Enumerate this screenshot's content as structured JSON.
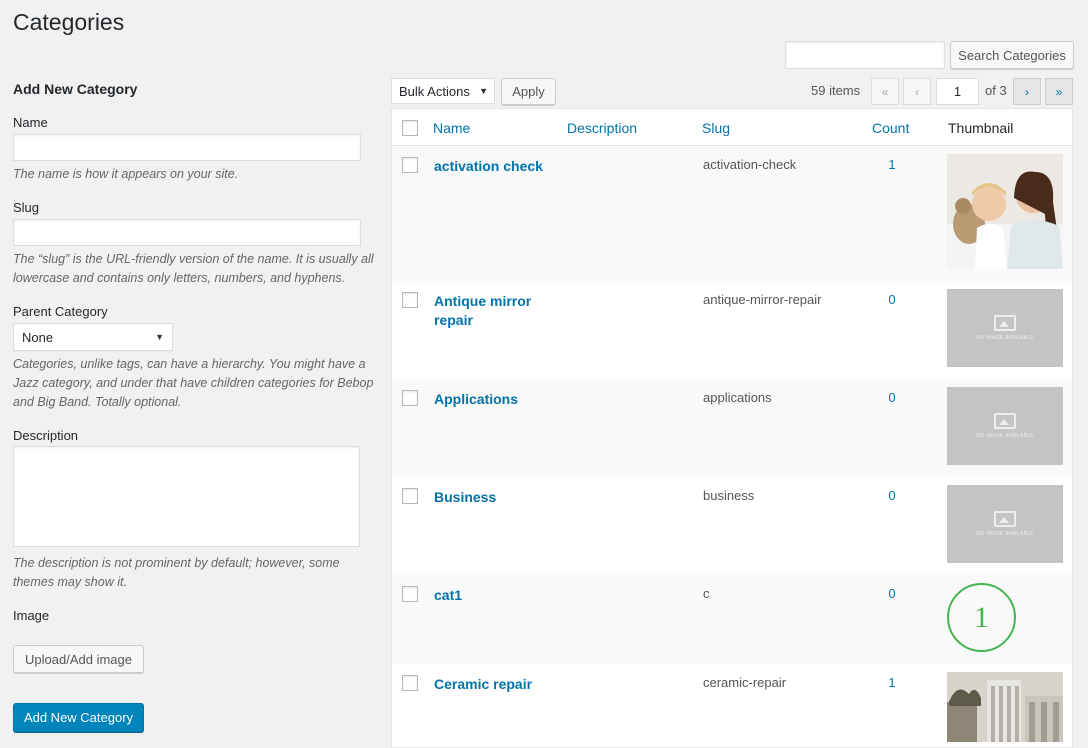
{
  "page": {
    "title": "Categories"
  },
  "search": {
    "button_label": "Search Categories",
    "value": ""
  },
  "form": {
    "heading": "Add New Category",
    "name_label": "Name",
    "name_help": "The name is how it appears on your site.",
    "slug_label": "Slug",
    "slug_help": "The “slug” is the URL-friendly version of the name. It is usually all lowercase and contains only letters, numbers, and hyphens.",
    "parent_label": "Parent Category",
    "parent_value": "None",
    "parent_help": "Categories, unlike tags, can have a hierarchy. You might have a Jazz category, and under that have children categories for Bebop and Big Band. Totally optional.",
    "description_label": "Description",
    "description_help": "The description is not prominent by default; however, some themes may show it.",
    "image_label": "Image",
    "upload_button": "Upload/Add image",
    "submit_button": "Add New Category"
  },
  "tablenav": {
    "bulk_actions": "Bulk Actions",
    "apply": "Apply",
    "items_count": "59 items",
    "first": "«",
    "prev": "‹",
    "current_page": "1",
    "of_pages": "of 3",
    "next": "›",
    "last": "»"
  },
  "table": {
    "columns": {
      "name": "Name",
      "description": "Description",
      "slug": "Slug",
      "count": "Count",
      "thumbnail": "Thumbnail"
    },
    "no_image_text": "NO IMAGE AVAILABLE",
    "rows": [
      {
        "name": "activation check",
        "slug": "activation-check",
        "count": "1",
        "thumbnail": "photo"
      },
      {
        "name": "Antique mirror repair",
        "slug": "antique-mirror-repair",
        "count": "0",
        "thumbnail": "no-image"
      },
      {
        "name": "Applications",
        "slug": "applications",
        "count": "0",
        "thumbnail": "no-image"
      },
      {
        "name": "Business",
        "slug": "business",
        "count": "0",
        "thumbnail": "no-image"
      },
      {
        "name": "cat1",
        "slug": "c",
        "count": "0",
        "thumbnail": "circle",
        "thumbnail_text": "1"
      },
      {
        "name": "Ceramic repair",
        "slug": "ceramic-repair",
        "count": "1",
        "thumbnail": "building-photo"
      }
    ]
  },
  "colors": {
    "link": "#0073aa",
    "primary_button": "#0085ba",
    "circle_badge": "#46b450"
  }
}
